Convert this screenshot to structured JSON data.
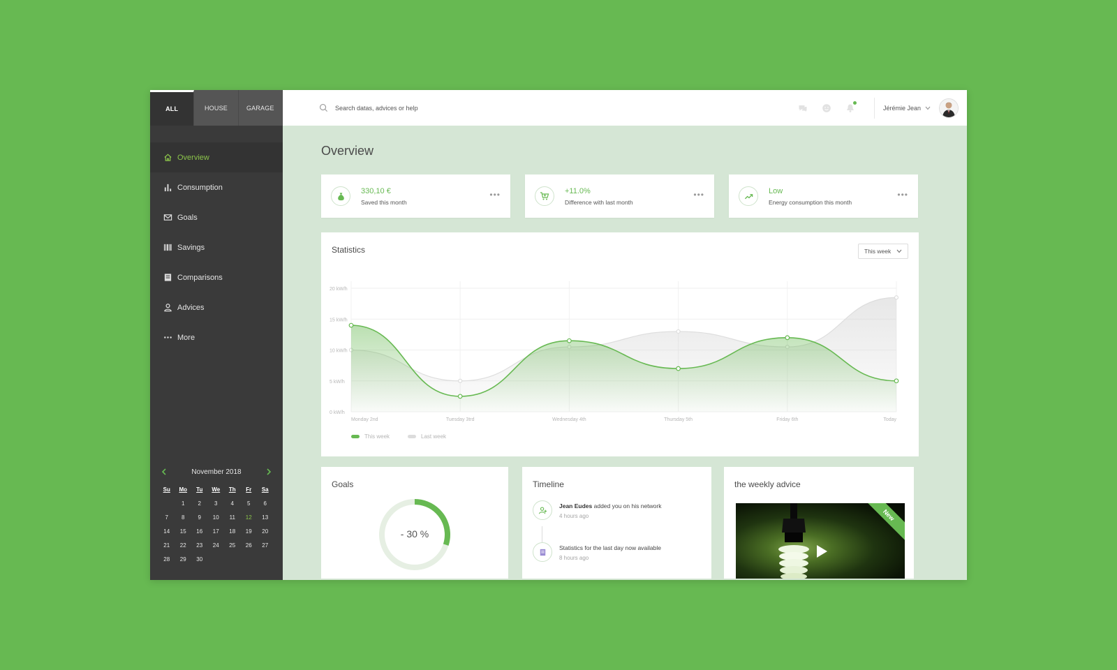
{
  "tabs": [
    {
      "label": "ALL",
      "active": true
    },
    {
      "label": "HOUSE",
      "active": false
    },
    {
      "label": "GARAGE",
      "active": false
    }
  ],
  "search": {
    "placeholder": "Search datas, advices or help"
  },
  "user": {
    "name": "Jérémie Jean"
  },
  "nav": [
    {
      "label": "Overview",
      "icon": "home-icon",
      "active": true
    },
    {
      "label": "Consumption",
      "icon": "bar-chart-icon"
    },
    {
      "label": "Goals",
      "icon": "envelope-icon"
    },
    {
      "label": "Savings",
      "icon": "barcode-icon"
    },
    {
      "label": "Comparisons",
      "icon": "list-icon"
    },
    {
      "label": "Advices",
      "icon": "user-icon"
    },
    {
      "label": "More",
      "icon": "more-icon"
    }
  ],
  "calendar": {
    "title": "November 2018",
    "weekdays": [
      "Su",
      "Mo",
      "Tu",
      "We",
      "Th",
      "Fr",
      "Sa"
    ],
    "first_weekday": 1,
    "days": 30,
    "today": 12
  },
  "page": {
    "title": "Overview"
  },
  "kpis": [
    {
      "value": "330,10 €",
      "label": "Saved this month",
      "icon": "money-bag-icon"
    },
    {
      "value": "+11.0%",
      "label": "Difference with last month",
      "icon": "cart-icon"
    },
    {
      "value": "Low",
      "label": "Energy consumption this month",
      "icon": "trending-up-icon"
    }
  ],
  "colors": {
    "accent": "#67b952",
    "sidebar": "#3a3a3a",
    "background": "#d5e6d5"
  },
  "statistics": {
    "title": "Statistics",
    "range": "This week"
  },
  "chart_data": {
    "type": "area",
    "categories": [
      "Monday 2nd",
      "Tuesday 3trd",
      "Wednesday 4th",
      "Thursday 5th",
      "Friday 6th",
      "Today"
    ],
    "series": [
      {
        "name": "This week",
        "values": [
          14,
          2.5,
          11.5,
          7,
          12,
          5
        ],
        "color": "#67b952"
      },
      {
        "name": "Last week",
        "values": [
          10,
          5,
          10.5,
          13,
          10.5,
          18.5
        ],
        "color": "#d9d9d9"
      }
    ],
    "y_ticks": [
      {
        "value": 20,
        "label": "20 kW/h"
      },
      {
        "value": 15,
        "label": "15 kW/h"
      },
      {
        "value": 10,
        "label": "10 kW/h"
      },
      {
        "value": 5,
        "label": "5 kW/h"
      },
      {
        "value": 0,
        "label": "0 kW/h"
      }
    ],
    "ylim": [
      0,
      20
    ],
    "grid": true,
    "legend_position": "bottom-left"
  },
  "goals": {
    "title": "Goals",
    "value_label": "- 30 %",
    "progress": 0.3
  },
  "timeline": {
    "title": "Timeline",
    "items": [
      {
        "name": "Jean Eudes",
        "text": " added you on his network",
        "time": "4 hours ago",
        "icon": "add-user-icon"
      },
      {
        "name": "",
        "text": "Statistics for the last day now available",
        "time": "8 hours ago",
        "icon": "document-icon"
      }
    ]
  },
  "advice": {
    "title": "the weekly advice",
    "badge": "New"
  }
}
